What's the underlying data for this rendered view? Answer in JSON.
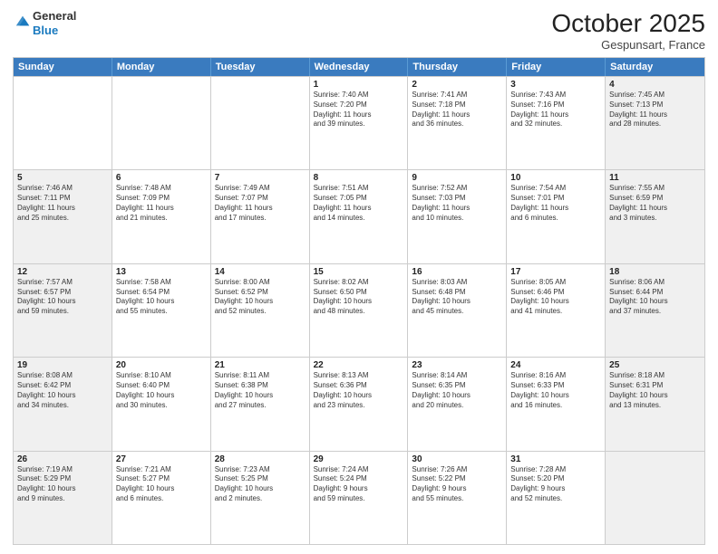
{
  "header": {
    "logo_line1": "General",
    "logo_line2": "Blue",
    "month": "October 2025",
    "location": "Gespunsart, France"
  },
  "weekdays": [
    "Sunday",
    "Monday",
    "Tuesday",
    "Wednesday",
    "Thursday",
    "Friday",
    "Saturday"
  ],
  "rows": [
    [
      {
        "day": "",
        "text": "",
        "shaded": false
      },
      {
        "day": "",
        "text": "",
        "shaded": false
      },
      {
        "day": "",
        "text": "",
        "shaded": false
      },
      {
        "day": "1",
        "text": "Sunrise: 7:40 AM\nSunset: 7:20 PM\nDaylight: 11 hours\nand 39 minutes.",
        "shaded": false
      },
      {
        "day": "2",
        "text": "Sunrise: 7:41 AM\nSunset: 7:18 PM\nDaylight: 11 hours\nand 36 minutes.",
        "shaded": false
      },
      {
        "day": "3",
        "text": "Sunrise: 7:43 AM\nSunset: 7:16 PM\nDaylight: 11 hours\nand 32 minutes.",
        "shaded": false
      },
      {
        "day": "4",
        "text": "Sunrise: 7:45 AM\nSunset: 7:13 PM\nDaylight: 11 hours\nand 28 minutes.",
        "shaded": true
      }
    ],
    [
      {
        "day": "5",
        "text": "Sunrise: 7:46 AM\nSunset: 7:11 PM\nDaylight: 11 hours\nand 25 minutes.",
        "shaded": true
      },
      {
        "day": "6",
        "text": "Sunrise: 7:48 AM\nSunset: 7:09 PM\nDaylight: 11 hours\nand 21 minutes.",
        "shaded": false
      },
      {
        "day": "7",
        "text": "Sunrise: 7:49 AM\nSunset: 7:07 PM\nDaylight: 11 hours\nand 17 minutes.",
        "shaded": false
      },
      {
        "day": "8",
        "text": "Sunrise: 7:51 AM\nSunset: 7:05 PM\nDaylight: 11 hours\nand 14 minutes.",
        "shaded": false
      },
      {
        "day": "9",
        "text": "Sunrise: 7:52 AM\nSunset: 7:03 PM\nDaylight: 11 hours\nand 10 minutes.",
        "shaded": false
      },
      {
        "day": "10",
        "text": "Sunrise: 7:54 AM\nSunset: 7:01 PM\nDaylight: 11 hours\nand 6 minutes.",
        "shaded": false
      },
      {
        "day": "11",
        "text": "Sunrise: 7:55 AM\nSunset: 6:59 PM\nDaylight: 11 hours\nand 3 minutes.",
        "shaded": true
      }
    ],
    [
      {
        "day": "12",
        "text": "Sunrise: 7:57 AM\nSunset: 6:57 PM\nDaylight: 10 hours\nand 59 minutes.",
        "shaded": true
      },
      {
        "day": "13",
        "text": "Sunrise: 7:58 AM\nSunset: 6:54 PM\nDaylight: 10 hours\nand 55 minutes.",
        "shaded": false
      },
      {
        "day": "14",
        "text": "Sunrise: 8:00 AM\nSunset: 6:52 PM\nDaylight: 10 hours\nand 52 minutes.",
        "shaded": false
      },
      {
        "day": "15",
        "text": "Sunrise: 8:02 AM\nSunset: 6:50 PM\nDaylight: 10 hours\nand 48 minutes.",
        "shaded": false
      },
      {
        "day": "16",
        "text": "Sunrise: 8:03 AM\nSunset: 6:48 PM\nDaylight: 10 hours\nand 45 minutes.",
        "shaded": false
      },
      {
        "day": "17",
        "text": "Sunrise: 8:05 AM\nSunset: 6:46 PM\nDaylight: 10 hours\nand 41 minutes.",
        "shaded": false
      },
      {
        "day": "18",
        "text": "Sunrise: 8:06 AM\nSunset: 6:44 PM\nDaylight: 10 hours\nand 37 minutes.",
        "shaded": true
      }
    ],
    [
      {
        "day": "19",
        "text": "Sunrise: 8:08 AM\nSunset: 6:42 PM\nDaylight: 10 hours\nand 34 minutes.",
        "shaded": true
      },
      {
        "day": "20",
        "text": "Sunrise: 8:10 AM\nSunset: 6:40 PM\nDaylight: 10 hours\nand 30 minutes.",
        "shaded": false
      },
      {
        "day": "21",
        "text": "Sunrise: 8:11 AM\nSunset: 6:38 PM\nDaylight: 10 hours\nand 27 minutes.",
        "shaded": false
      },
      {
        "day": "22",
        "text": "Sunrise: 8:13 AM\nSunset: 6:36 PM\nDaylight: 10 hours\nand 23 minutes.",
        "shaded": false
      },
      {
        "day": "23",
        "text": "Sunrise: 8:14 AM\nSunset: 6:35 PM\nDaylight: 10 hours\nand 20 minutes.",
        "shaded": false
      },
      {
        "day": "24",
        "text": "Sunrise: 8:16 AM\nSunset: 6:33 PM\nDaylight: 10 hours\nand 16 minutes.",
        "shaded": false
      },
      {
        "day": "25",
        "text": "Sunrise: 8:18 AM\nSunset: 6:31 PM\nDaylight: 10 hours\nand 13 minutes.",
        "shaded": true
      }
    ],
    [
      {
        "day": "26",
        "text": "Sunrise: 7:19 AM\nSunset: 5:29 PM\nDaylight: 10 hours\nand 9 minutes.",
        "shaded": true
      },
      {
        "day": "27",
        "text": "Sunrise: 7:21 AM\nSunset: 5:27 PM\nDaylight: 10 hours\nand 6 minutes.",
        "shaded": false
      },
      {
        "day": "28",
        "text": "Sunrise: 7:23 AM\nSunset: 5:25 PM\nDaylight: 10 hours\nand 2 minutes.",
        "shaded": false
      },
      {
        "day": "29",
        "text": "Sunrise: 7:24 AM\nSunset: 5:24 PM\nDaylight: 9 hours\nand 59 minutes.",
        "shaded": false
      },
      {
        "day": "30",
        "text": "Sunrise: 7:26 AM\nSunset: 5:22 PM\nDaylight: 9 hours\nand 55 minutes.",
        "shaded": false
      },
      {
        "day": "31",
        "text": "Sunrise: 7:28 AM\nSunset: 5:20 PM\nDaylight: 9 hours\nand 52 minutes.",
        "shaded": false
      },
      {
        "day": "",
        "text": "",
        "shaded": true
      }
    ]
  ]
}
